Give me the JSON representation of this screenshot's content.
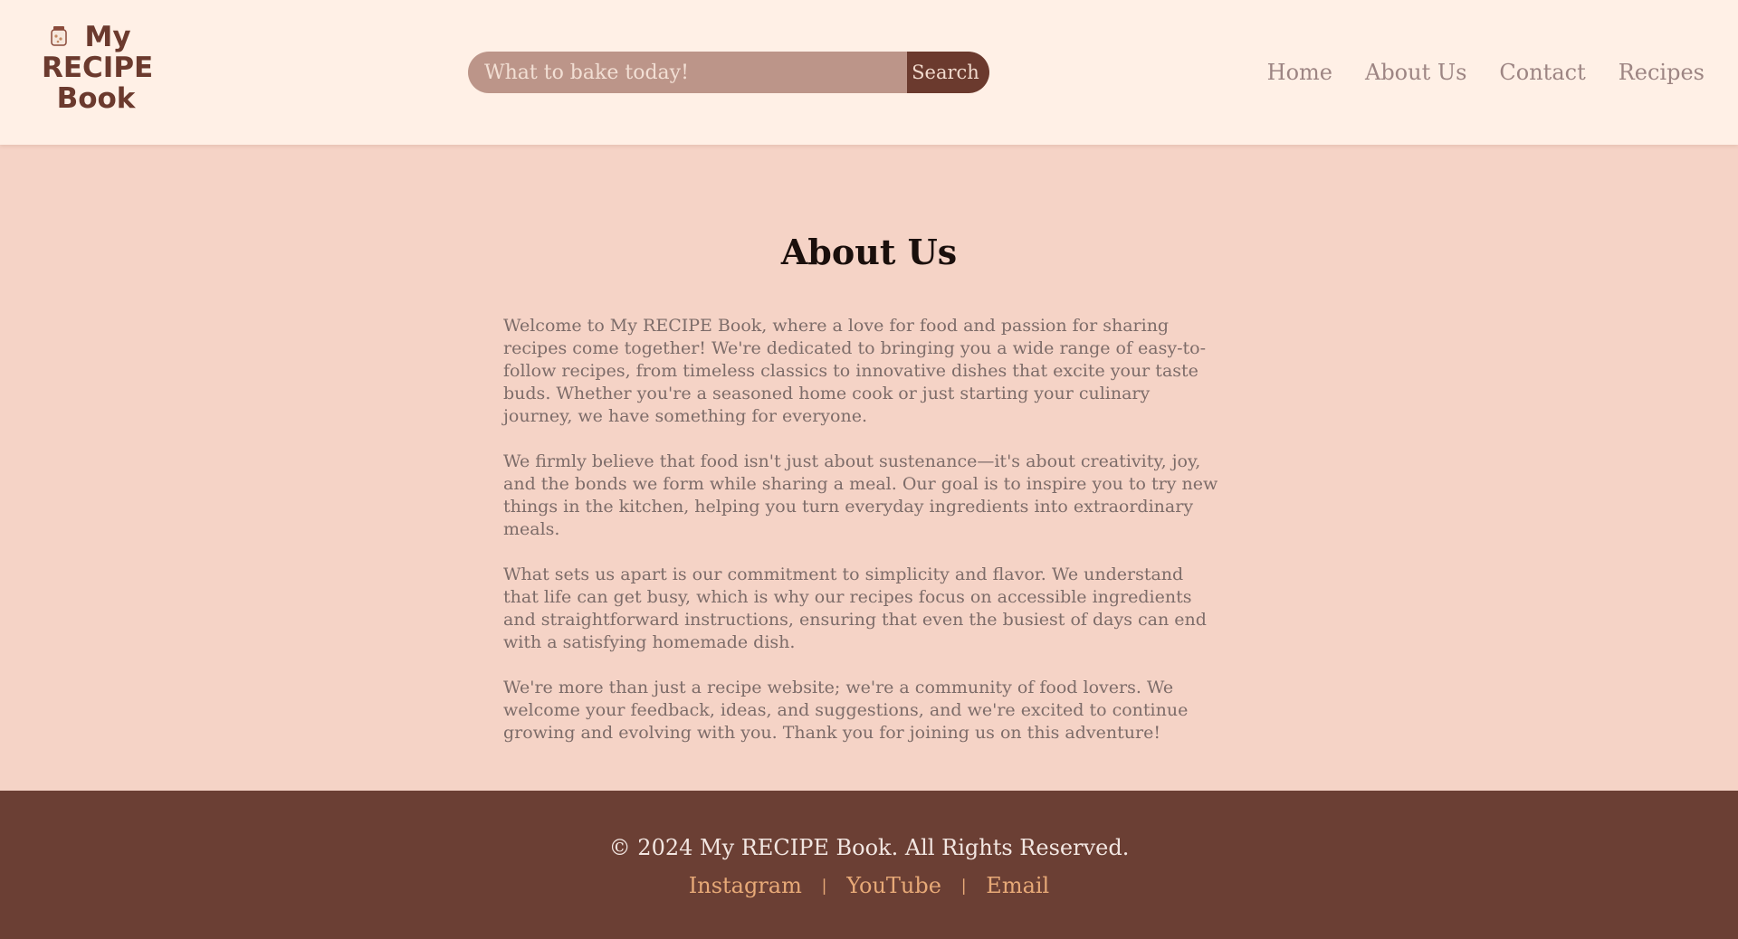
{
  "header": {
    "logo": {
      "line1": "My",
      "line2": "RECIPE",
      "line3": "Book",
      "icon": "cookie-jar-icon"
    },
    "search": {
      "placeholder": "What to bake today!",
      "value": "",
      "button_label": "Search"
    },
    "nav": [
      {
        "label": "Home"
      },
      {
        "label": "About Us"
      },
      {
        "label": "Contact"
      },
      {
        "label": "Recipes"
      }
    ]
  },
  "main": {
    "title": "About Us",
    "paragraphs": [
      "Welcome to My RECIPE Book, where a love for food and passion for sharing recipes come together! We're dedicated to bringing you a wide range of easy-to-follow recipes, from timeless classics to innovative dishes that excite your taste buds. Whether you're a seasoned home cook or just starting your culinary journey, we have something for everyone.",
      "We firmly believe that food isn't just about sustenance—it's about creativity, joy, and the bonds we form while sharing a meal. Our goal is to inspire you to try new things in the kitchen, helping you turn everyday ingredients into extraordinary meals.",
      "What sets us apart is our commitment to simplicity and flavor. We understand that life can get busy, which is why our recipes focus on accessible ingredients and straightforward instructions, ensuring that even the busiest of days can end with a satisfying homemade dish.",
      "We're more than just a recipe website; we're a community of food lovers. We welcome your feedback, ideas, and suggestions, and we're excited to continue growing and evolving with you. Thank you for joining us on this adventure!"
    ]
  },
  "footer": {
    "copyright": "© 2024 My RECIPE Book. All Rights Reserved.",
    "links": [
      {
        "label": "Instagram"
      },
      {
        "label": "YouTube"
      },
      {
        "label": "Email"
      }
    ],
    "separator": "|"
  },
  "colors": {
    "header_bg": "#fff0e6",
    "page_bg": "#f5d3c6",
    "brand_brown": "#6b3a2e",
    "footer_bg": "#6b3f34",
    "footer_link": "#e7a977",
    "nav_text": "#9d8583"
  }
}
